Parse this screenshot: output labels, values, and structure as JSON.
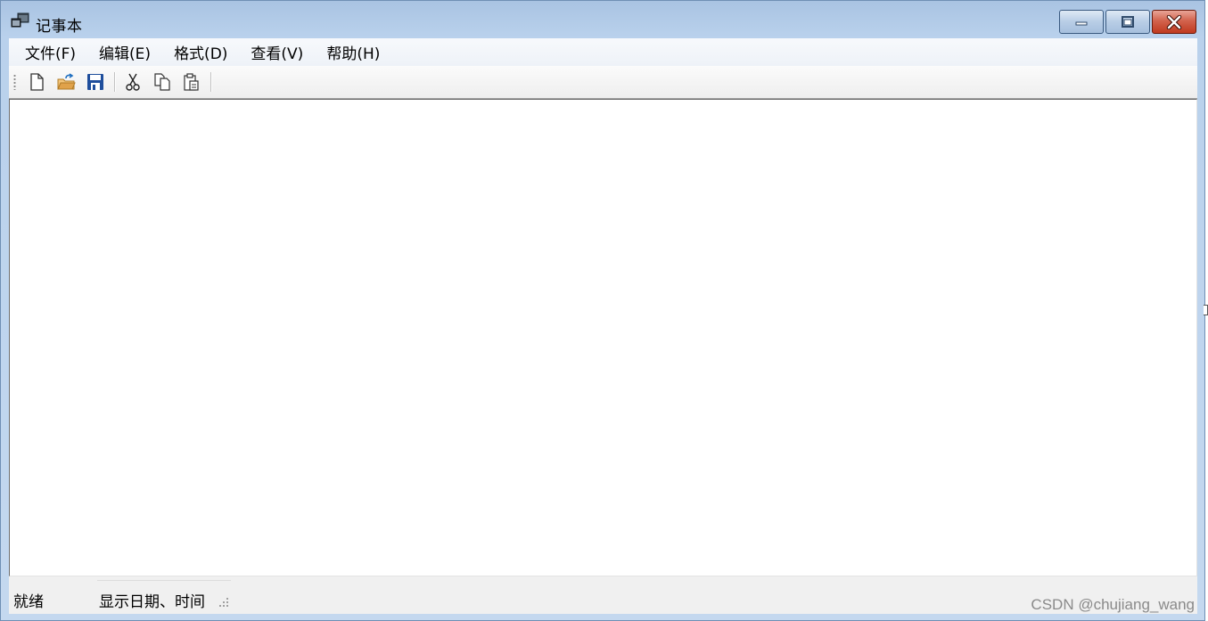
{
  "window": {
    "title": "记事本",
    "icon": "app-window-icon",
    "controls": {
      "minimize_icon": "minimize-icon",
      "maximize_icon": "maximize-icon",
      "close_icon": "close-icon"
    }
  },
  "menubar": {
    "items": [
      {
        "label": "文件(F)"
      },
      {
        "label": "编辑(E)"
      },
      {
        "label": "格式(D)"
      },
      {
        "label": "查看(V)"
      },
      {
        "label": "帮助(H)"
      }
    ]
  },
  "toolbar": {
    "buttons": [
      {
        "icon": "new-document-icon"
      },
      {
        "icon": "open-folder-icon"
      },
      {
        "icon": "save-icon"
      },
      {
        "icon": "cut-icon"
      },
      {
        "icon": "copy-icon"
      },
      {
        "icon": "paste-icon"
      }
    ]
  },
  "editor": {
    "text": ""
  },
  "statusbar": {
    "ready": "就绪",
    "datetime": "显示日期、时间"
  },
  "watermark": "CSDN @chujiang_wang",
  "colors": {
    "title_gradient_top": "#a9c3e2",
    "close_button": "#c0391f",
    "save_icon_blue": "#1f4e9c",
    "open_folder_orange": "#e0a24a"
  }
}
